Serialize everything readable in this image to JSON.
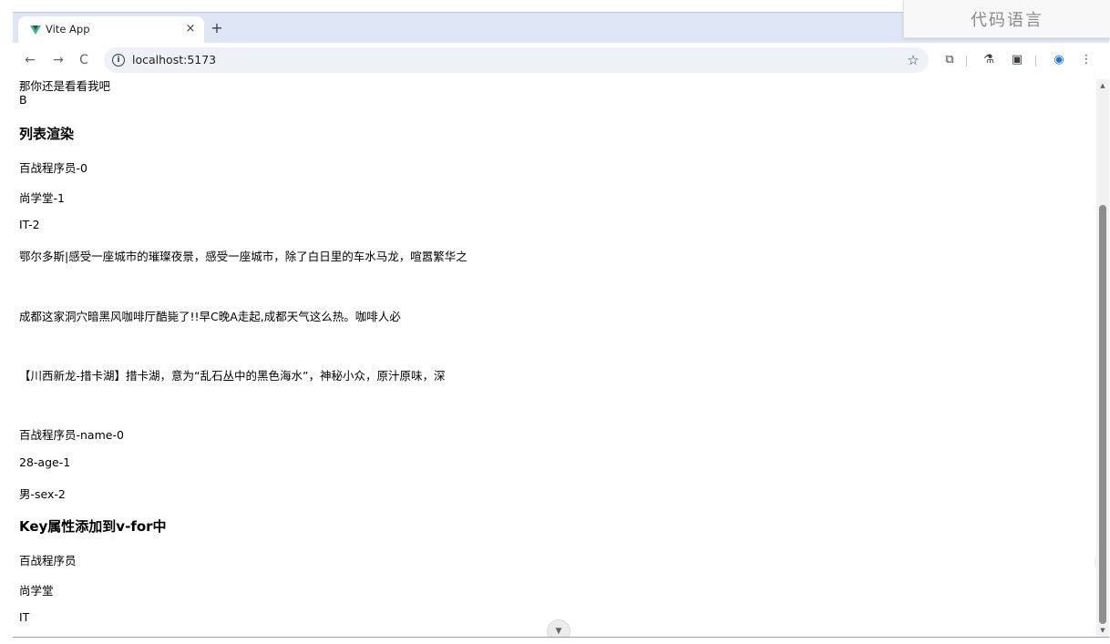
{
  "browser": {
    "tab": {
      "title": "Vite App",
      "close_label": "×"
    },
    "new_tab_label": "+",
    "nav": {
      "back": "←",
      "forward": "→",
      "reload": "C"
    },
    "address": {
      "info": "i",
      "url": "localhost:5173"
    },
    "icons": {
      "bookmark": "☆",
      "extensions": "⧉",
      "labs": "⚗",
      "media": "▣",
      "profile": "◉",
      "menu": "⋮"
    }
  },
  "ime": {
    "label": "代码语言"
  },
  "page": {
    "partial_line": "那你还是看看我吧",
    "letter_b": "B",
    "section1_title": "列表渲染",
    "list1": [
      "百战程序员-0",
      "尚学堂-1",
      "IT-2"
    ],
    "articles": [
      "鄂尔多斯|感受一座城市的璀璨夜景，感受一座城市，除了白日里的车水马龙，喧嚣繁华之",
      "成都这家洞穴暗黑风咖啡厅酷毙了!!早C晚A走起,成都天气这么热。咖啡人必",
      "【川西新龙-措卡湖】措卡湖，意为“乱石丛中的黑色海水”，神秘小众，原汁原味，深"
    ],
    "list2": [
      "百战程序员-name-0",
      "28-age-1",
      "男-sex-2"
    ],
    "section2_title": "Key属性添加到v-for中",
    "list3": [
      "百战程序员",
      "尚学堂",
      "IT"
    ]
  },
  "scrollbar": {
    "up": "▲",
    "down": "▼"
  },
  "float": {
    "scroll_down": "▼"
  }
}
